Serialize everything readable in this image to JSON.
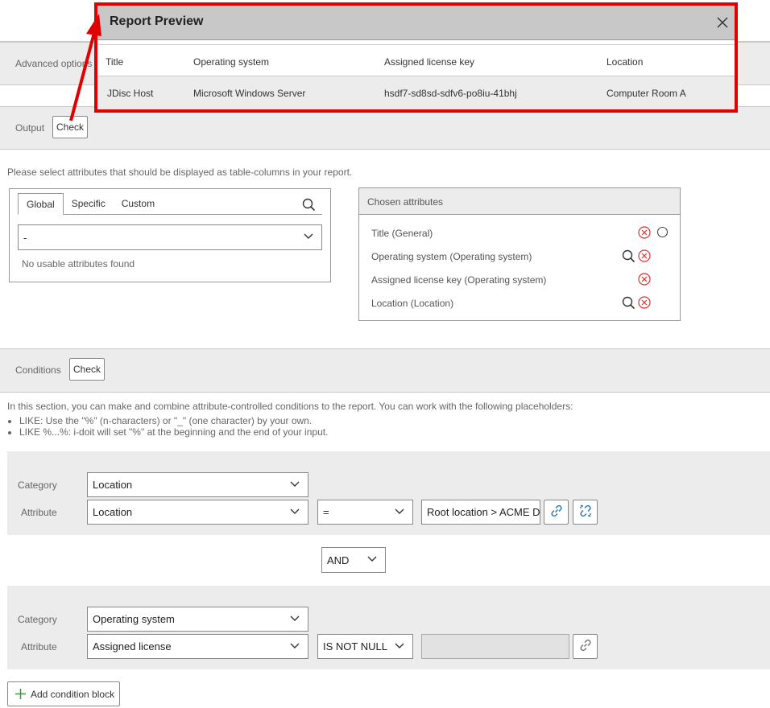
{
  "modal": {
    "title": "Report Preview",
    "columns": [
      "Title",
      "Operating system",
      "Assigned license key",
      "Location"
    ],
    "row": [
      "JDisc Host",
      "Microsoft Windows Server",
      "hsdf7-sd8sd-sdfv6-po8iu-41bhj",
      "Computer Room A"
    ]
  },
  "advanced": {
    "label": "Advanced options"
  },
  "output": {
    "label": "Output",
    "check_label": "Check",
    "hint": "Please select attributes that should be displayed as table-columns in your report."
  },
  "attr_selector": {
    "tabs": [
      "Global",
      "Specific",
      "Custom"
    ],
    "active_tab": "Global",
    "select_value": "-",
    "empty_text": "No usable attributes found"
  },
  "chosen": {
    "header": "Chosen attributes",
    "items": [
      {
        "label": "Title (General)",
        "search": false,
        "radio": true
      },
      {
        "label": "Operating system (Operating system)",
        "search": true,
        "radio": false
      },
      {
        "label": "Assigned license key (Operating system)",
        "search": false,
        "radio": false
      },
      {
        "label": "Location (Location)",
        "search": true,
        "radio": false
      }
    ]
  },
  "conditions": {
    "label": "Conditions",
    "check_label": "Check",
    "intro": "In this section, you can make and combine attribute-controlled conditions to the report. You can work with the following placeholders:",
    "bullets": [
      "LIKE: Use the \"%\" (n-characters) or \"_\" (one character) by your own.",
      "LIKE %...%: i-doit will set \"%\" at the beginning and the end of your input."
    ],
    "block1": {
      "category_label": "Category",
      "category_value": "Location",
      "attribute_label": "Attribute",
      "attribute_value": "Location",
      "operator": "=",
      "value": "Root location > ACME D"
    },
    "connector": "AND",
    "block2": {
      "category_label": "Category",
      "category_value": "Operating system",
      "attribute_label": "Attribute",
      "attribute_value": "Assigned license",
      "operator": "IS NOT NULL",
      "value": ""
    },
    "add_block_label": "Add condition block"
  },
  "colors": {
    "highlight": "#e00000",
    "error_icon": "#e03030"
  }
}
